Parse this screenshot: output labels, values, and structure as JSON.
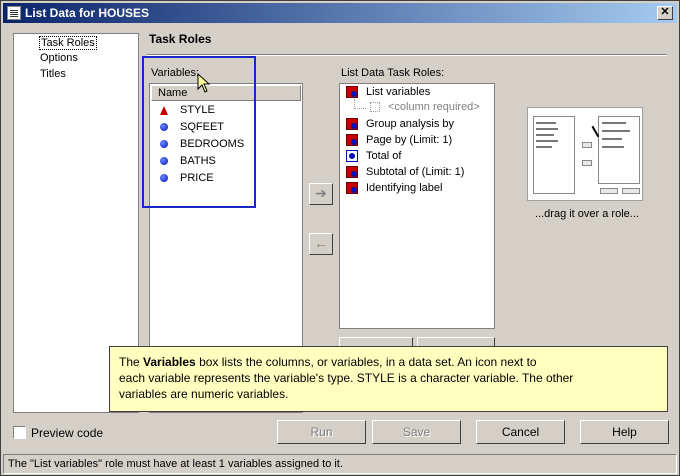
{
  "window": {
    "title": "List Data for HOUSES",
    "close_label": "✕"
  },
  "nav": {
    "items": [
      "Task Roles",
      "Options",
      "Titles"
    ],
    "selected": 0
  },
  "section": {
    "title": "Task Roles"
  },
  "variables": {
    "label": "Variables:",
    "column_header": "Name",
    "items": [
      {
        "name": "STYLE",
        "type": "character"
      },
      {
        "name": "SQFEET",
        "type": "numeric"
      },
      {
        "name": "BEDROOMS",
        "type": "numeric"
      },
      {
        "name": "BATHS",
        "type": "numeric"
      },
      {
        "name": "PRICE",
        "type": "numeric"
      }
    ]
  },
  "arrows": {
    "add": "➔",
    "remove": "←"
  },
  "roles": {
    "label": "List Data Task Roles:",
    "items": [
      {
        "name": "List variables",
        "icon": "mixed"
      },
      {
        "name": "Group analysis by",
        "icon": "mixed"
      },
      {
        "name": "Page by  (Limit: 1)",
        "icon": "mixed"
      },
      {
        "name": "Total of",
        "icon": "numeric"
      },
      {
        "name": "Subtotal of  (Limit: 1)",
        "icon": "mixed"
      },
      {
        "name": "Identifying label",
        "icon": "mixed"
      }
    ],
    "required_placeholder": "<column required>"
  },
  "drag_hint": {
    "caption": "...drag it over a role..."
  },
  "tooltip": {
    "bold_word": "Variables",
    "pre": "The ",
    "line1_rest": " box lists the columns, or variables, in a data set.  An icon next to",
    "line2": "each variable represents the variable's type.  STYLE is a character variable. The other",
    "line3": "variables are numeric variables."
  },
  "preview": {
    "label": "Preview code",
    "checked": false
  },
  "buttons": {
    "run": "Run",
    "save": "Save",
    "cancel": "Cancel",
    "help": "Help"
  },
  "status": {
    "text": "The \"List variables\" role must have at least 1 variables assigned to it."
  },
  "colors": {
    "title_start": "#0a246a",
    "title_end": "#a6caf0",
    "highlight": "#1a26c8",
    "tooltip_bg": "#ffffc0"
  }
}
